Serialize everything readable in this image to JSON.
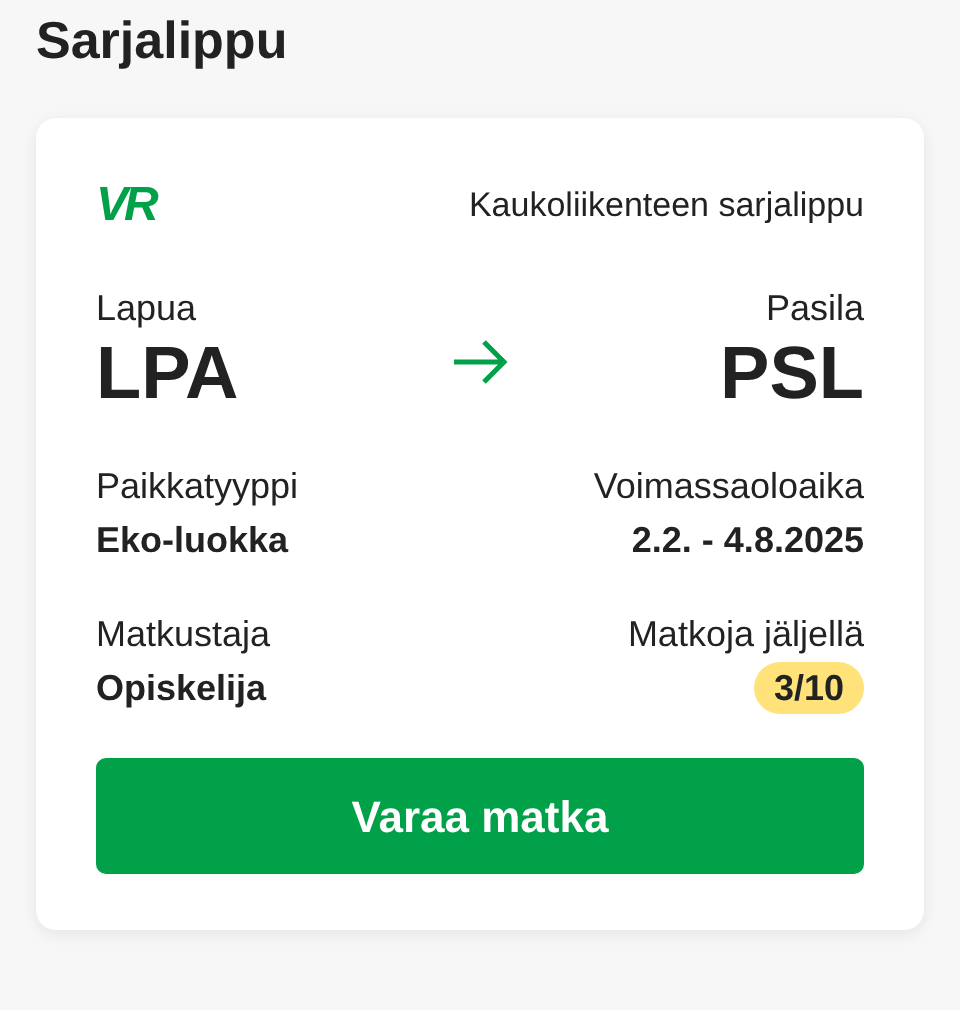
{
  "page": {
    "title": "Sarjalippu"
  },
  "ticket": {
    "logo": "VR",
    "product": "Kaukoliikenteen sarjalippu",
    "from": {
      "name": "Lapua",
      "code": "LPA"
    },
    "to": {
      "name": "Pasila",
      "code": "PSL"
    },
    "details": [
      {
        "label": "Paikkatyyppi",
        "value": "Eko-luokka",
        "kind": "text"
      },
      {
        "label": "Voimassaoloaika",
        "value": "2.2. - 4.8.2025",
        "kind": "text"
      },
      {
        "label": "Matkustaja",
        "value": "Opiskelija",
        "kind": "text"
      },
      {
        "label": "Matkoja jäljellä",
        "value": "3/10",
        "kind": "badge"
      }
    ],
    "button": "Varaa matka"
  }
}
